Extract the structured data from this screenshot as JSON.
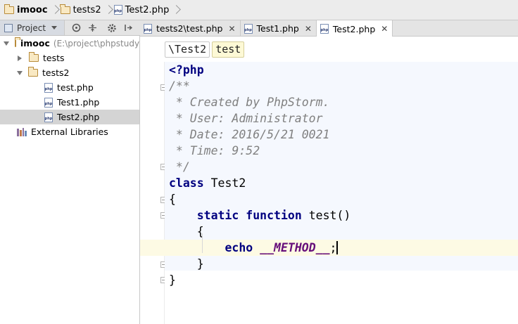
{
  "breadcrumb": [
    {
      "icon": "folder-icon",
      "label": "imooc",
      "bold": true
    },
    {
      "icon": "folder-icon",
      "label": "tests2",
      "bold": false
    },
    {
      "icon": "php-file-icon",
      "label": "Test2.php",
      "bold": false
    }
  ],
  "project_panel": {
    "tab_label": "Project",
    "tree": [
      {
        "label": "imooc",
        "path": "(E:\\project\\phpstudy",
        "type": "folder",
        "expanded": true,
        "bold": true
      },
      {
        "label": "tests",
        "type": "folder",
        "expanded": false
      },
      {
        "label": "tests2",
        "type": "folder",
        "expanded": true
      },
      {
        "label": "test.php",
        "type": "php"
      },
      {
        "label": "Test1.php",
        "type": "php"
      },
      {
        "label": "Test2.php",
        "type": "php",
        "selected": true
      },
      {
        "label": "External Libraries",
        "type": "library"
      }
    ]
  },
  "editor_tabs": [
    {
      "label": "tests2\\test.php",
      "active": false
    },
    {
      "label": "Test1.php",
      "active": false
    },
    {
      "label": "Test2.php",
      "active": true
    }
  ],
  "editor_breadcrumbs": [
    "\\Test2",
    "test"
  ],
  "code": {
    "open_tag": "<?php",
    "comment_open": "/**",
    "comment_created": " * Created by PhpStorm.",
    "comment_user": " * User: Administrator",
    "comment_date": " * Date: 2016/5/21 0021",
    "comment_time": " * Time: 9:52",
    "comment_close": " */",
    "kw_class": "class",
    "class_name": " Test2",
    "brace_open": "{",
    "indent_1": "    ",
    "kw_static": "static",
    "kw_function": " function",
    "method_sig": " test()",
    "indent_brace_open": "    {",
    "indent_2": "        ",
    "kw_echo": "echo",
    "space": " ",
    "magic_const": "__METHOD__",
    "semicolon": ";",
    "indent_brace_close": "    }",
    "brace_close": "}"
  },
  "colors": {
    "keyword": "#000080",
    "comment": "#808080",
    "magic_constant": "#660e7a",
    "current_line": "#fdfae4"
  }
}
